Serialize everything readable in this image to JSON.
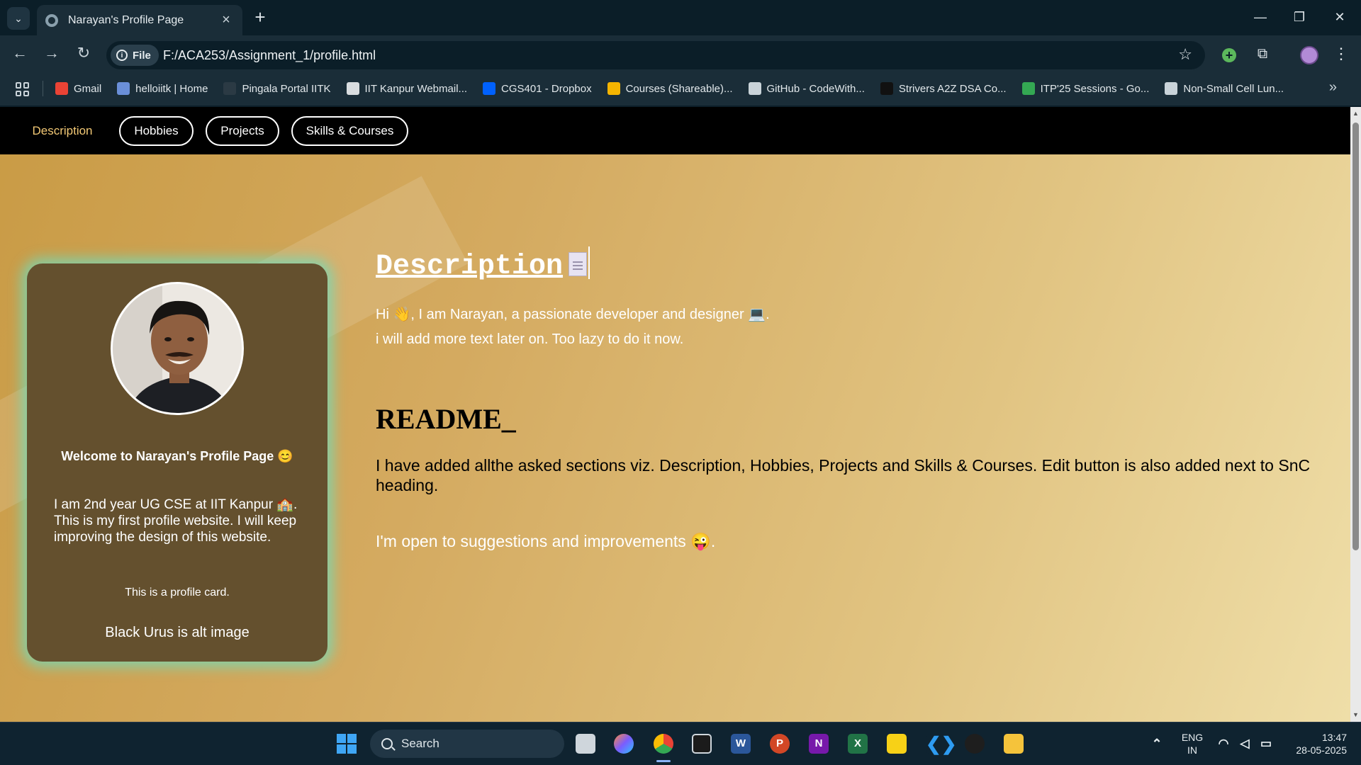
{
  "browser": {
    "tab_title": "Narayan's Profile Page",
    "url_scheme": "File",
    "url": "F:/ACA253/Assignment_1/profile.html",
    "bookmarks": [
      {
        "label": "Gmail",
        "color": "#ea4335"
      },
      {
        "label": "helloiitk | Home",
        "color": "#6a8fd8"
      },
      {
        "label": "Pingala Portal IITK",
        "color": "#2b3a44"
      },
      {
        "label": "IIT Kanpur Webmail...",
        "color": "#d9dde0"
      },
      {
        "label": "CGS401 - Dropbox",
        "color": "#0061fe"
      },
      {
        "label": "Courses (Shareable)...",
        "color": "#f4b400"
      },
      {
        "label": "GitHub - CodeWith...",
        "color": "#c9d3d9"
      },
      {
        "label": "Strivers A2Z DSA Co...",
        "color": "#111111"
      },
      {
        "label": "ITP'25 Sessions - Go...",
        "color": "#34a853"
      },
      {
        "label": "Non-Small Cell Lun...",
        "color": "#c9d3d9"
      }
    ]
  },
  "site_nav": {
    "items": [
      "Description",
      "Hobbies",
      "Projects",
      "Skills & Courses"
    ],
    "active": "Description"
  },
  "profile_card": {
    "title": "Welcome to Narayan's Profile Page 😊",
    "text": "I am 2nd year UG CSE at IIT Kanpur 🏫. This is my first profile website. I will keep improving the design of this website.",
    "note": "This is a profile card.",
    "alt_text": "Black Urus is alt image"
  },
  "main": {
    "description_heading": "Description",
    "intro": "Hi 👋, I am Narayan, a passionate developer and designer 💻.",
    "note": "i will add more text later on. Too lazy to do it now.",
    "readme_heading": "README_",
    "readme_text": "I have added allthe asked sections viz. Description, Hobbies, Projects and Skills & Courses. Edit button is also added next to SnC heading.",
    "suggestion": "I'm open to suggestions and improvements 😜."
  },
  "taskbar": {
    "search_label": "Search",
    "lang_line1": "ENG",
    "lang_line2": "IN",
    "time": "13:47",
    "date": "28-05-2025"
  },
  "colors": {
    "nav_active": "#f2c875",
    "card_bg": "#64502e",
    "card_glow": "#6edcbe",
    "page_gradient_start": "#c99b45",
    "page_gradient_end": "#efdea8"
  }
}
